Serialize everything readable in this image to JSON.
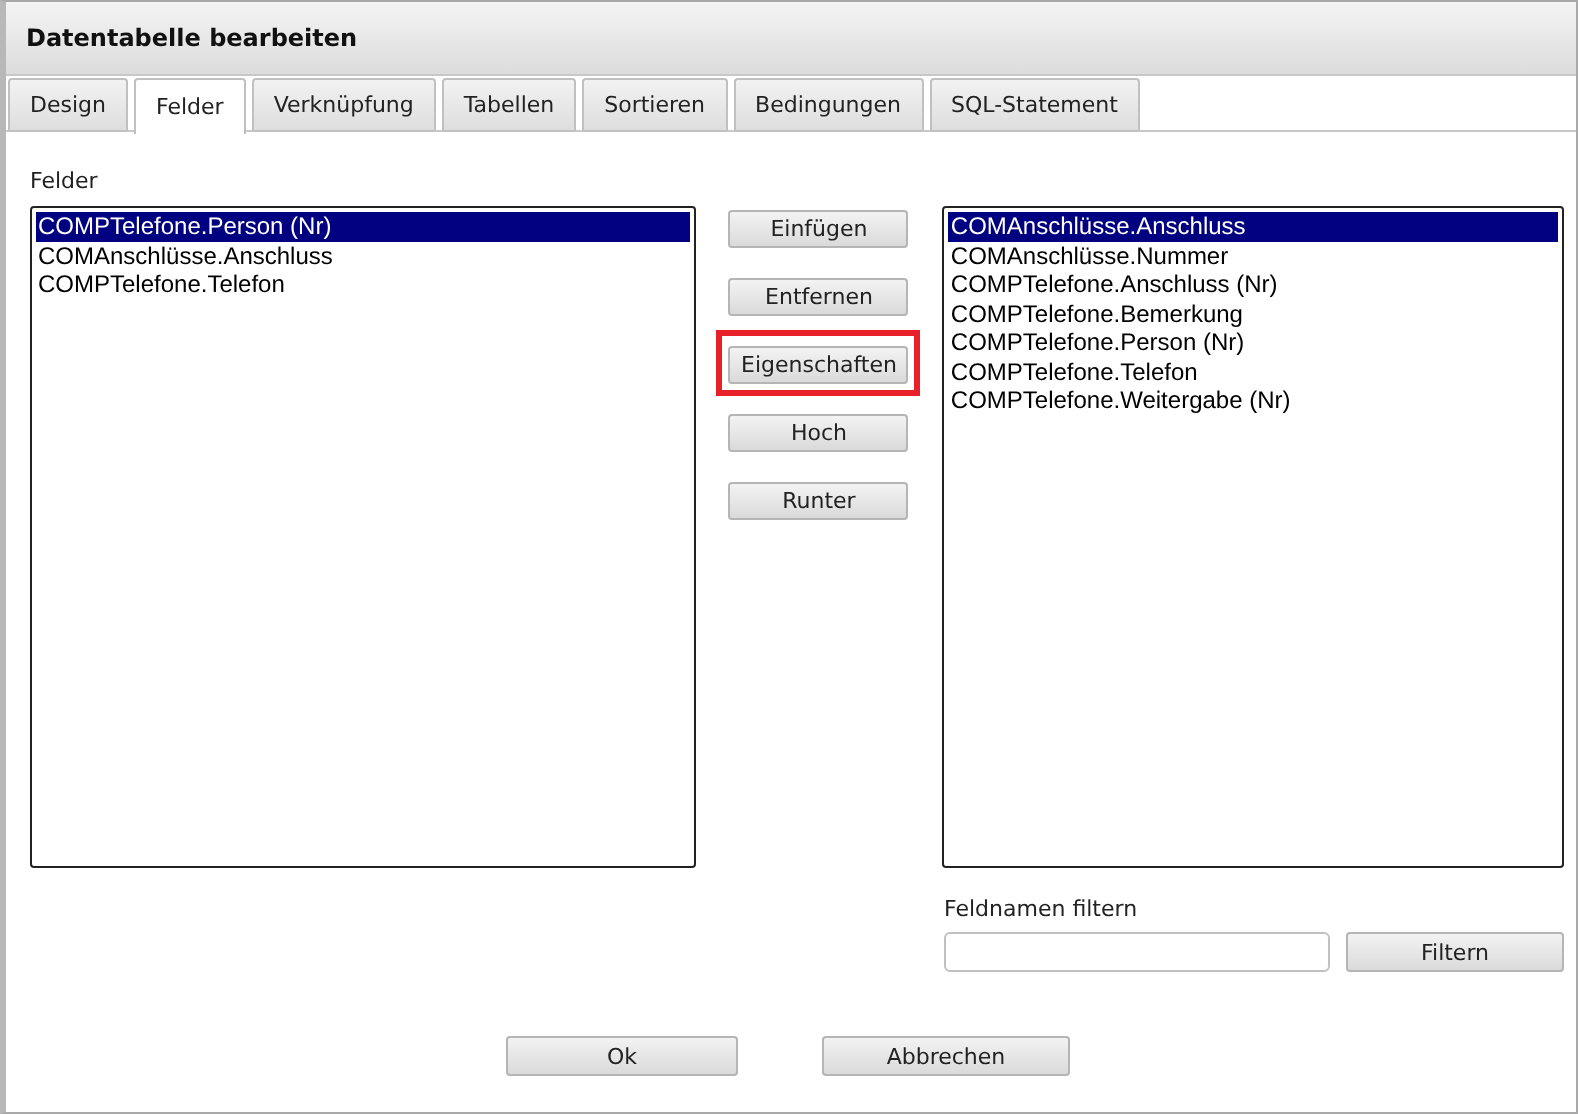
{
  "window": {
    "title": "Datentabelle bearbeiten"
  },
  "tabs": [
    {
      "label": "Design",
      "selected": false
    },
    {
      "label": "Felder",
      "selected": true
    },
    {
      "label": "Verknüpfung",
      "selected": false
    },
    {
      "label": "Tabellen",
      "selected": false
    },
    {
      "label": "Sortieren",
      "selected": false
    },
    {
      "label": "Bedingungen",
      "selected": false
    },
    {
      "label": "SQL-Statement",
      "selected": false
    }
  ],
  "fields_label": "Felder",
  "selected_fields": [
    {
      "label": "COMPTelefone.Person (Nr)",
      "selected": true
    },
    {
      "label": "COMAnschlüsse.Anschluss",
      "selected": false
    },
    {
      "label": "COMPTelefone.Telefon",
      "selected": false
    }
  ],
  "middle_buttons": [
    {
      "label": "Einfügen",
      "highlighted": false
    },
    {
      "label": "Entfernen",
      "highlighted": false
    },
    {
      "label": "Eigenschaften",
      "highlighted": true
    },
    {
      "label": "Hoch",
      "highlighted": false
    },
    {
      "label": "Runter",
      "highlighted": false
    }
  ],
  "available_fields": [
    {
      "label": "COMAnschlüsse.Anschluss",
      "selected": true
    },
    {
      "label": "COMAnschlüsse.Nummer",
      "selected": false
    },
    {
      "label": "COMPTelefone.Anschluss (Nr)",
      "selected": false
    },
    {
      "label": "COMPTelefone.Bemerkung",
      "selected": false
    },
    {
      "label": "COMPTelefone.Person (Nr)",
      "selected": false
    },
    {
      "label": "COMPTelefone.Telefon",
      "selected": false
    },
    {
      "label": "COMPTelefone.Weitergabe (Nr)",
      "selected": false
    }
  ],
  "filter": {
    "label": "Feldnamen filtern",
    "button": "Filtern"
  },
  "buttons": [
    "Ok",
    "Abbrechen"
  ]
}
